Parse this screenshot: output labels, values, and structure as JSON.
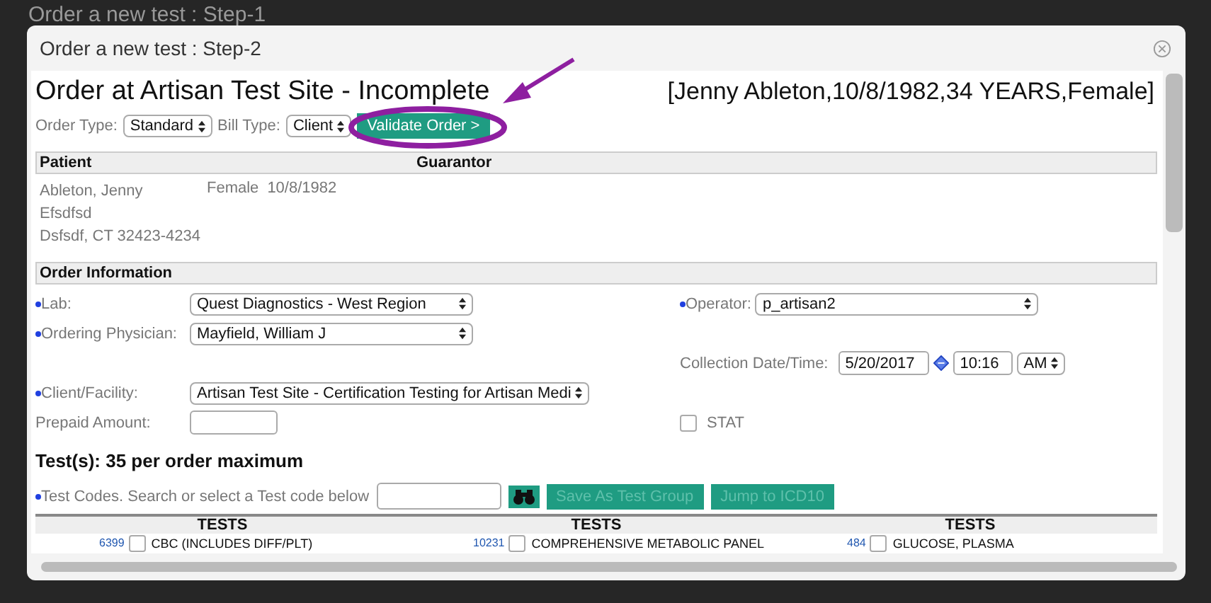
{
  "background": {
    "title": "Order a new test : Step-1"
  },
  "dialog": {
    "title": "Order a new test : Step-2"
  },
  "header": {
    "heading": "Order at Artisan Test Site - Incomplete",
    "patient_summary": "[Jenny Ableton,10/8/1982,34 YEARS,Female]"
  },
  "order_bar": {
    "order_type": {
      "label": "Order Type:",
      "value": "Standard"
    },
    "bill_type": {
      "label": "Bill Type:",
      "value": "Client"
    },
    "validate_button": "Validate Order >"
  },
  "patient_table": {
    "columns": [
      "Patient",
      "Guarantor"
    ],
    "address_lines": [
      "Ableton, Jenny",
      "Efsdfsd",
      "Dsfsdf, CT 32423-4234"
    ],
    "sex": "Female",
    "dob": "10/8/1982"
  },
  "order_information": {
    "title": "Order Information",
    "rows": [
      {
        "left": {
          "kind": "select",
          "label": "Lab:",
          "required": true,
          "value": "Quest Diagnostics - West Region"
        },
        "right": {
          "kind": "select",
          "label": "Operator:",
          "required": true,
          "value": "p_artisan2"
        }
      },
      {
        "left": {
          "kind": "select",
          "label": "Ordering Physician:",
          "required": true,
          "value": "Mayfield, William J"
        }
      },
      {
        "right": {
          "kind": "datetime",
          "label": "Collection Date/Time:",
          "required": false,
          "date": "5/20/2017",
          "time": "10:16",
          "ampm": "AM"
        }
      },
      {
        "left": {
          "kind": "select",
          "label": "Client/Facility:",
          "required": true,
          "value": "Artisan Test Site - Certification Testing for Artisan Medi"
        }
      },
      {
        "left": {
          "kind": "input",
          "label": "Prepaid Amount:",
          "required": false
        },
        "right": {
          "kind": "checkbox",
          "label": "STAT",
          "required": false,
          "checked": false
        }
      }
    ]
  },
  "tests": {
    "heading": "Test(s): 35 per order maximum",
    "search_label": "Test Codes. Search or select a Test code below",
    "search_required": true,
    "buttons": [
      {
        "label": "Save As Test Group",
        "disabled": true
      },
      {
        "label": "Jump to ICD10",
        "disabled": true
      }
    ],
    "columns": [
      "TESTS",
      "TESTS",
      "TESTS"
    ],
    "items": [
      {
        "code": "6399",
        "name": "CBC (INCLUDES DIFF/PLT)",
        "checked": false
      },
      {
        "code": "10231",
        "name": "COMPREHENSIVE METABOLIC PANEL",
        "checked": false
      },
      {
        "code": "484",
        "name": "GLUCOSE, PLASMA",
        "checked": false
      }
    ]
  }
}
